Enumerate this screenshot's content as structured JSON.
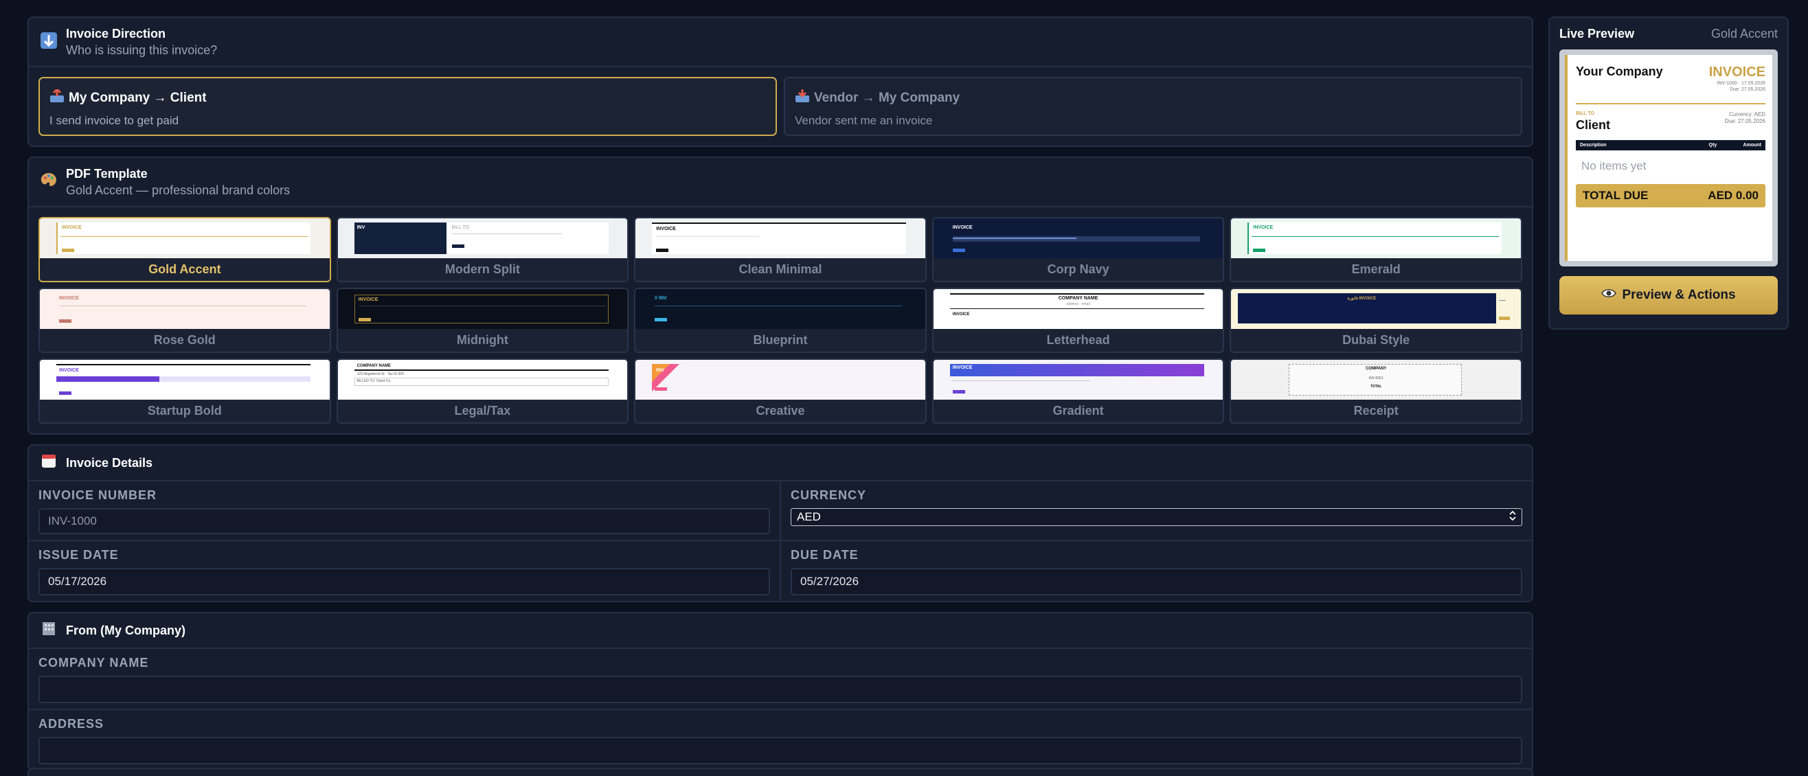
{
  "direction": {
    "icon": "down-arrow-box-icon",
    "title": "Invoice Direction",
    "subtitle": "Who is issuing this invoice?",
    "options": [
      {
        "icon": "outbox-tray-icon",
        "title": "My Company → Client",
        "subtitle": "I send invoice to get paid",
        "selected": true
      },
      {
        "icon": "inbox-tray-icon",
        "title": "Vendor → My Company",
        "subtitle": "Vendor sent me an invoice",
        "selected": false
      }
    ]
  },
  "templates": {
    "icon": "palette-icon",
    "title": "PDF Template",
    "subtitle": "Gold Accent — professional brand colors",
    "items": [
      {
        "name": "Gold Accent",
        "selected": true
      },
      {
        "name": "Modern Split"
      },
      {
        "name": "Clean Minimal"
      },
      {
        "name": "Corp Navy"
      },
      {
        "name": "Emerald"
      },
      {
        "name": "Rose Gold"
      },
      {
        "name": "Midnight"
      },
      {
        "name": "Blueprint"
      },
      {
        "name": "Letterhead"
      },
      {
        "name": "Dubai Style"
      },
      {
        "name": "Startup Bold"
      },
      {
        "name": "Legal/Tax"
      },
      {
        "name": "Creative"
      },
      {
        "name": "Gradient"
      },
      {
        "name": "Receipt"
      }
    ],
    "thumb_text": {
      "invoice": "INVOICE",
      "inv_short": "INV",
      "bill_to": "BILL TO",
      "blueprint": "// INV",
      "company_name": "COMPANY NAME",
      "address": "address · email",
      "dubai": "فاتورة INVOICE",
      "legal_address": "123 Registered St · Tax ID 000",
      "legal_bill": "BILLED TO: Client Co.",
      "receipt_company": "COMPANY",
      "receipt_no": "INV-0001",
      "receipt_total": "TOTAL"
    }
  },
  "details": {
    "icon": "calendar-icon",
    "title": "Invoice Details",
    "invoice_number": {
      "label": "INVOICE NUMBER",
      "placeholder": "INV-1000"
    },
    "currency": {
      "label": "CURRENCY",
      "value": "AED"
    },
    "issue_date": {
      "label": "ISSUE DATE",
      "value": "05/17/2026"
    },
    "due_date": {
      "label": "DUE DATE",
      "value": "05/27/2026"
    }
  },
  "from": {
    "icon": "office-building-icon",
    "title": "From (My Company)",
    "company_name": {
      "label": "COMPANY NAME",
      "value": ""
    },
    "address": {
      "label": "ADDRESS",
      "value": ""
    }
  },
  "preview": {
    "title": "Live Preview",
    "template": "Gold Accent",
    "paper": {
      "company": "Your Company",
      "doc_title": "INVOICE",
      "meta_number": "INV-1000 · 17.05.2026",
      "meta_due": "Due: 27.05.2026",
      "bill_to_label": "BILL TO",
      "client": "Client",
      "currency_line": "Currency: AED",
      "due_line": "Due: 27.05.2026",
      "col_description": "Description",
      "col_qty": "Qty",
      "col_amount": "Amount",
      "empty": "No items yet",
      "total_label": "TOTAL DUE",
      "total_value": "AED 0.00"
    },
    "button_icon": "eye-icon",
    "button_label": "Preview & Actions"
  },
  "colors": {
    "background": "#0c1120",
    "card": "#161d2e",
    "accent_gold": "#d3ad4e",
    "border": "#252f44"
  }
}
